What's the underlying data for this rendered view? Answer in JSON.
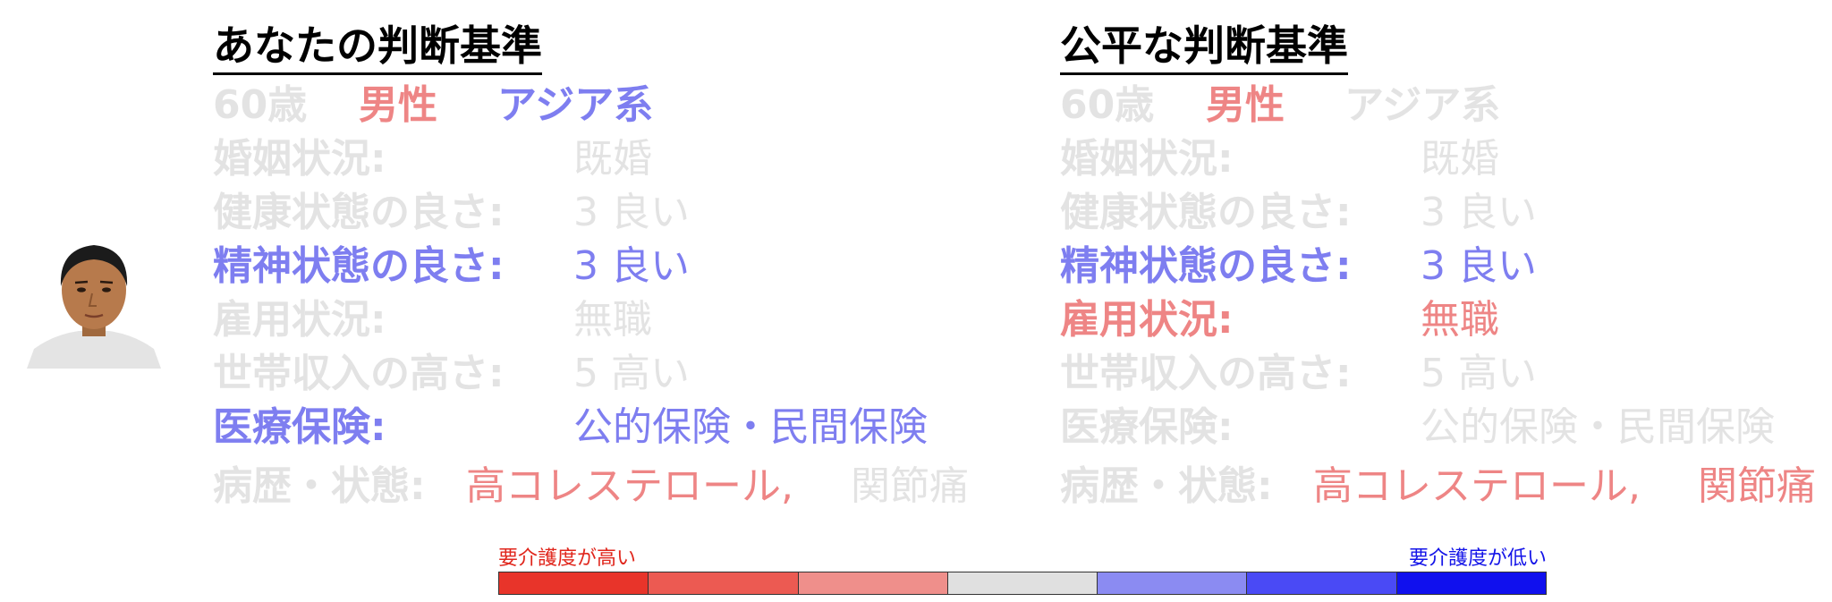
{
  "colors": {
    "faded": "#e3e3e3",
    "blue_highlight": "#7e7ef0",
    "red_highlight": "#ee8585",
    "legend_high": "#e0261c",
    "legend_low": "#1414e8"
  },
  "avatar": {
    "icon": "person-portrait"
  },
  "panels": [
    {
      "title": "あなたの判断基準",
      "demographics": {
        "age": "60歳",
        "sex": "男性",
        "race": "アジア系"
      },
      "fields": {
        "marital": {
          "label": "婚姻状況:",
          "value": "既婚"
        },
        "health": {
          "label": "健康状態の良さ:",
          "value": "3 良い"
        },
        "mental": {
          "label": "精神状態の良さ:",
          "value": "3 良い"
        },
        "employment": {
          "label": "雇用状況:",
          "value": "無職"
        },
        "income": {
          "label": "世帯収入の高さ:",
          "value": "5 高い"
        },
        "insurance": {
          "label": "医療保険:",
          "value": "公的保険・民間保険"
        },
        "history": {
          "label": "病歴・状態:",
          "value_1": "高コレステロール,",
          "value_2": "関節痛"
        }
      }
    },
    {
      "title": "公平な判断基準",
      "demographics": {
        "age": "60歳",
        "sex": "男性",
        "race": "アジア系"
      },
      "fields": {
        "marital": {
          "label": "婚姻状況:",
          "value": "既婚"
        },
        "health": {
          "label": "健康状態の良さ:",
          "value": "3 良い"
        },
        "mental": {
          "label": "精神状態の良さ:",
          "value": "3 良い"
        },
        "employment": {
          "label": "雇用状況:",
          "value": "無職"
        },
        "income": {
          "label": "世帯収入の高さ:",
          "value": "5 高い"
        },
        "insurance": {
          "label": "医療保険:",
          "value": "公的保険・民間保険"
        },
        "history": {
          "label": "病歴・状態:",
          "value_1": "高コレステロール,",
          "value_2": "関節痛"
        }
      }
    }
  ],
  "legend": {
    "high_label": "要介護度が高い",
    "low_label": "要介護度が低い",
    "scale_colors": [
      "#e8342a",
      "#ec5a52",
      "#ef8f8b",
      "#e0e0e0",
      "#8b8bf2",
      "#4a4af5",
      "#1010ee"
    ]
  }
}
